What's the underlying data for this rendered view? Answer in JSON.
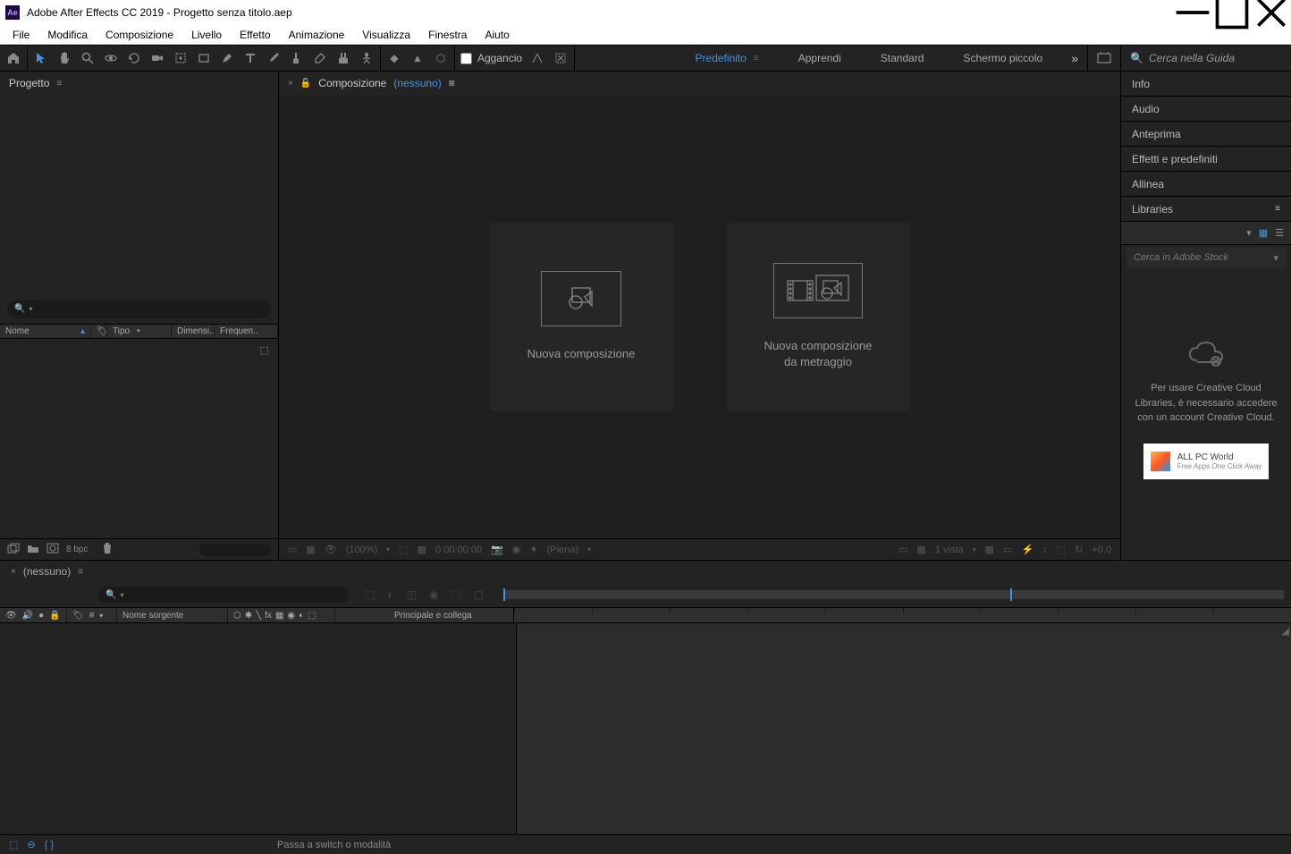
{
  "titlebar": {
    "app": "Ae",
    "title": "Adobe After Effects CC 2019 - Progetto senza titolo.aep"
  },
  "menubar": [
    "File",
    "Modifica",
    "Composizione",
    "Livello",
    "Effetto",
    "Animazione",
    "Visualizza",
    "Finestra",
    "Aiuto"
  ],
  "toolbar": {
    "aggancio_label": "Aggancio",
    "workspaces": [
      {
        "label": "Predefinito",
        "active": true,
        "bars": true
      },
      {
        "label": "Apprendi",
        "active": false
      },
      {
        "label": "Standard",
        "active": false
      },
      {
        "label": "Schermo piccolo",
        "active": false
      }
    ],
    "search_placeholder": "Cerca nella Guida"
  },
  "project": {
    "tab": "Progetto",
    "cols": [
      "Nome",
      "",
      "Tipo",
      "Dimensi..",
      "Frequen.."
    ],
    "footer_bpc": "8 bpc"
  },
  "comp": {
    "tab_label": "Composizione",
    "tab_none": "(nessuno)",
    "btn1": "Nuova composizione",
    "btn2_l1": "Nuova composizione",
    "btn2_l2": "da metraggio",
    "footer": {
      "zoom": "(100%)",
      "time": "0:00:00:00",
      "res": "(Piena)",
      "view": "1 vista",
      "deg": "+0,0"
    }
  },
  "right": {
    "panels": [
      "Info",
      "Audio",
      "Anteprima",
      "Effetti e predefiniti",
      "Allinea"
    ],
    "lib_title": "Libraries",
    "lib_search": "Cerca in Adobe Stock",
    "lib_msg": "Per usare Creative Cloud Libraries, è necessario accedere con un account Creative Cloud.",
    "lib_brand_l1": "ALL PC World",
    "lib_brand_l2": "Free Apps One Click Away"
  },
  "timeline": {
    "tab": "(nessuno)",
    "col_nome": "Nome sorgente",
    "col_principale": "Principale e collega",
    "num": "#"
  },
  "statusbar": {
    "msg": "Passa a switch o modalità"
  }
}
